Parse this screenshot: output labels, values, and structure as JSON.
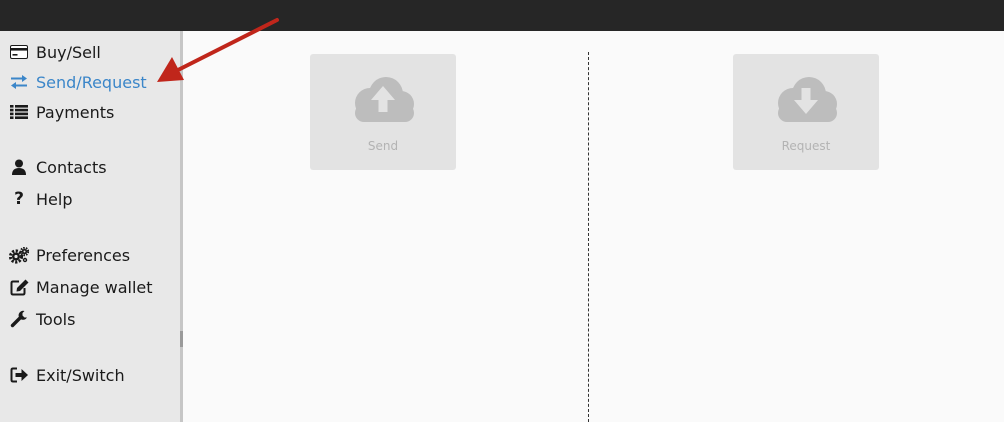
{
  "sidebar": {
    "items": [
      {
        "label": "Buy/Sell",
        "icon": "credit-card-icon"
      },
      {
        "label": "Send/Request",
        "icon": "exchange-arrows-icon",
        "active": true
      },
      {
        "label": "Payments",
        "icon": "list-icon"
      },
      {
        "label": "Contacts",
        "icon": "user-icon"
      },
      {
        "label": "Help",
        "icon": "question-icon"
      },
      {
        "label": "Preferences",
        "icon": "gears-icon"
      },
      {
        "label": "Manage wallet",
        "icon": "edit-icon"
      },
      {
        "label": "Tools",
        "icon": "wrench-icon"
      },
      {
        "label": "Exit/Switch",
        "icon": "sign-out-icon"
      }
    ]
  },
  "main": {
    "send": {
      "label": "Send",
      "icon": "cloud-upload-icon"
    },
    "request": {
      "label": "Request",
      "icon": "cloud-download-icon"
    }
  },
  "colors": {
    "active_nav": "#3b86c9",
    "annotation_arrow": "#c0261b",
    "topbar": "#262626",
    "sidebar_bg": "#e8e8e8",
    "tile_bg": "#e3e3e3",
    "tile_icon": "#bdbdbd"
  }
}
